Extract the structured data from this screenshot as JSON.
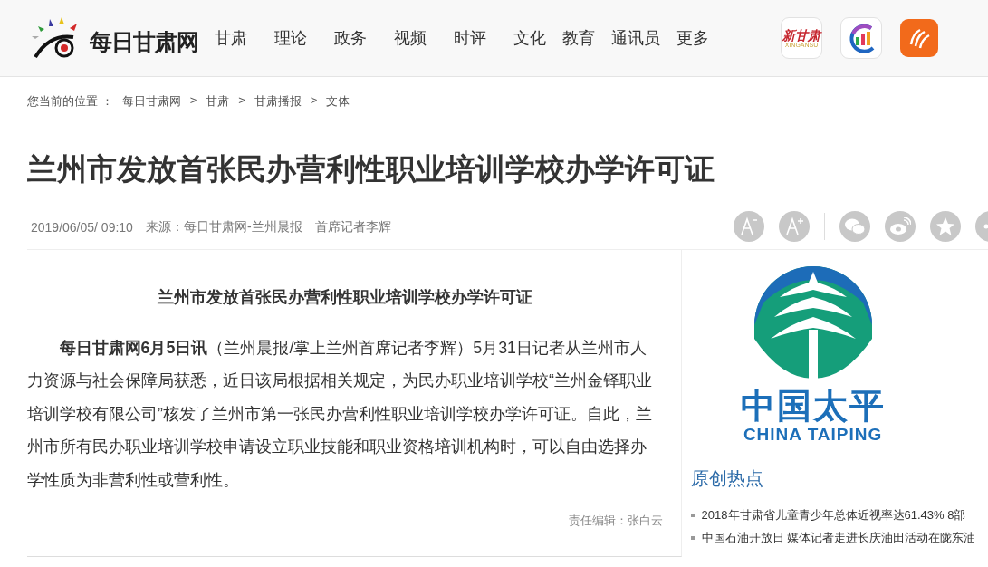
{
  "header": {
    "logo_text": "每日甘肃网",
    "nav": [
      {
        "label": "甘肃"
      },
      {
        "label": "理论"
      },
      {
        "label": "政务"
      },
      {
        "label": "视频"
      },
      {
        "label": "时评"
      },
      {
        "label": "文化"
      },
      {
        "label": "教育"
      },
      {
        "label": "通讯员"
      },
      {
        "label": "更多"
      }
    ],
    "apps": [
      {
        "kind": "xingansu",
        "name": "新甘肃",
        "caption": "XINGANSU"
      },
      {
        "kind": "chart"
      },
      {
        "kind": "orange"
      }
    ]
  },
  "breadcrumb": {
    "label": "您当前的位置 ：",
    "items": [
      "每日甘肃网",
      "甘肃",
      "甘肃播报",
      "文体"
    ],
    "separator": ">"
  },
  "article": {
    "title": "兰州市发放首张民办营利性职业培训学校办学许可证",
    "date": "2019/06/05/ 09:10",
    "source": "来源：每日甘肃网-兰州晨报",
    "author": "首席记者李辉",
    "tools": [
      {
        "kind": "font-smaller"
      },
      {
        "kind": "font-larger"
      },
      {
        "kind": "divider"
      },
      {
        "kind": "wechat"
      },
      {
        "kind": "weibo"
      },
      {
        "kind": "qzone"
      },
      {
        "kind": "more"
      }
    ],
    "heading": "兰州市发放首张民办营利性职业培训学校办学许可证",
    "paragraph": "**每日甘肃网6月5日讯**（兰州晨报/掌上兰州首席记者李辉）5月31日记者从兰州市人力资源与社会保障局获悉，近日该局根据相关规定，为民办职业培训学校“兰州金铎职业培训学校有限公司”核发了兰州市第一张民办营利性职业培训学校办学许可证。自此，兰州市所有民办职业培训学校申请设立职业技能和职业资格培训机构时，可以自由选择办学性质为非营利性或营利性。",
    "editor": "责任编辑：张白云"
  },
  "sidebar": {
    "ad": {
      "cn": "中国太平",
      "en": "CHINA TAIPING"
    },
    "hot_title": "原创热点",
    "hot_items": [
      "2018年甘肃省儿童青少年总体近视率达61.43% 8部",
      "中国石油开放日 媒体记者走进长庆油田活动在陇东油"
    ]
  }
}
